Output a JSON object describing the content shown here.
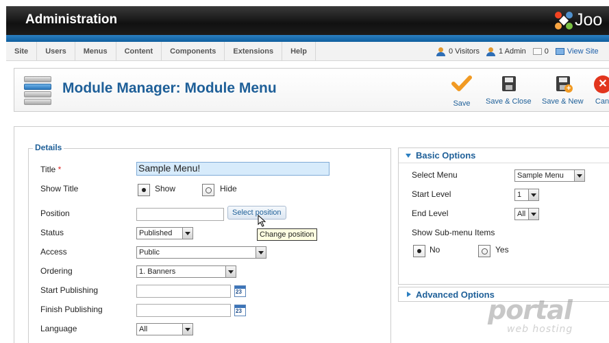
{
  "header": {
    "title": "Administration",
    "logo_text": "Joo"
  },
  "menu": {
    "items": [
      "Site",
      "Users",
      "Menus",
      "Content",
      "Components",
      "Extensions",
      "Help"
    ]
  },
  "status": {
    "visitors": "0 Visitors",
    "admins": "1 Admin",
    "messages": "0",
    "view_site": "View Site"
  },
  "toolbar": {
    "page_title": "Module Manager: Module Menu",
    "save": "Save",
    "save_close": "Save & Close",
    "save_new": "Save & New",
    "cancel": "Can"
  },
  "details": {
    "legend": "Details",
    "title_label": "Title",
    "required_mark": "*",
    "title_value": "Sample Menu!",
    "show_title_label": "Show Title",
    "show_option": "Show",
    "hide_option": "Hide",
    "position_label": "Position",
    "position_value": "",
    "select_position": "Select position",
    "tooltip": "Change position",
    "status_label": "Status",
    "status_value": "Published",
    "access_label": "Access",
    "access_value": "Public",
    "ordering_label": "Ordering",
    "ordering_value": "1. Banners",
    "start_pub_label": "Start Publishing",
    "finish_pub_label": "Finish Publishing",
    "calendar_day": "23",
    "language_label": "Language",
    "language_value": "All"
  },
  "basic_options": {
    "header": "Basic Options",
    "select_menu_label": "Select Menu",
    "select_menu_value": "Sample Menu",
    "start_level_label": "Start Level",
    "start_level_value": "1",
    "end_level_label": "End Level",
    "end_level_value": "All",
    "submenu_label": "Show Sub-menu Items",
    "no_option": "No",
    "yes_option": "Yes"
  },
  "advanced_options": {
    "header": "Advanced Options"
  },
  "watermark": {
    "line1": "portal",
    "line2": "web hosting"
  },
  "colors": {
    "accent": "#1e5f98",
    "bluebar": "#2b7fc1",
    "title_highlight": "#d7ebfb"
  }
}
